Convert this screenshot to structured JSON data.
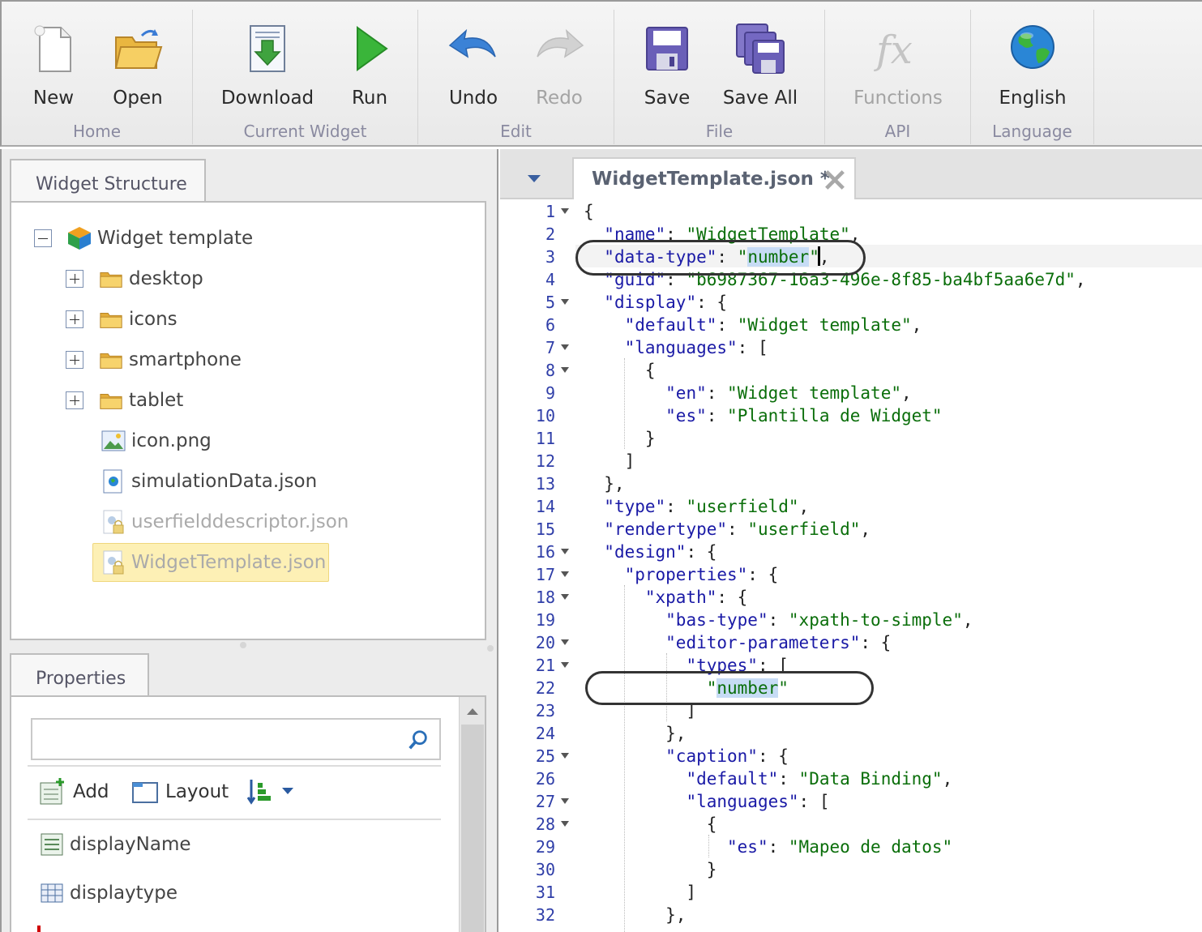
{
  "ribbon": {
    "groups": [
      {
        "label": "Home",
        "buttons": [
          {
            "label": "New"
          },
          {
            "label": "Open"
          }
        ]
      },
      {
        "label": "Current Widget",
        "buttons": [
          {
            "label": "Download"
          },
          {
            "label": "Run"
          }
        ]
      },
      {
        "label": "Edit",
        "buttons": [
          {
            "label": "Undo"
          },
          {
            "label": "Redo"
          }
        ]
      },
      {
        "label": "File",
        "buttons": [
          {
            "label": "Save"
          },
          {
            "label": "Save All"
          }
        ]
      },
      {
        "label": "API",
        "buttons": [
          {
            "label": "Functions"
          }
        ]
      },
      {
        "label": "Language",
        "buttons": [
          {
            "label": "English"
          }
        ]
      }
    ]
  },
  "structure": {
    "tab_label": "Widget Structure",
    "root": "Widget template",
    "folders": [
      "desktop",
      "icons",
      "smartphone",
      "tablet"
    ],
    "files": [
      "icon.png",
      "simulationData.json",
      "userfielddescriptor.json",
      "WidgetTemplate.json"
    ],
    "selected": "WidgetTemplate.json"
  },
  "properties": {
    "tab_label": "Properties",
    "search_value": "",
    "toolbar": {
      "add_label": "Add",
      "layout_label": "Layout"
    },
    "items": [
      "displayName",
      "displaytype"
    ]
  },
  "editor": {
    "tab_title": "WidgetTemplate.json *",
    "lines": [
      "{",
      "  \"name\": \"WidgetTemplate\",",
      "  \"data-type\": \"number\",",
      "  \"guid\": \"b6987367-16a3-496e-8f85-ba4bf5aa6e7d\",",
      "  \"display\": {",
      "    \"default\": \"Widget template\",",
      "    \"languages\": [",
      "      {",
      "        \"en\": \"Widget template\",",
      "        \"es\": \"Plantilla de Widget\"",
      "      }",
      "    ]",
      "  },",
      "  \"type\": \"userfield\",",
      "  \"rendertype\": \"userfield\",",
      "  \"design\": {",
      "    \"properties\": {",
      "      \"xpath\": {",
      "        \"bas-type\": \"xpath-to-simple\",",
      "        \"editor-parameters\": {",
      "          \"types\": [",
      "            \"number\"",
      "          ]",
      "        },",
      "        \"caption\": {",
      "          \"default\": \"Data Binding\",",
      "          \"languages\": [",
      "            {",
      "              \"es\": \"Mapeo de datos\"",
      "            }",
      "          ]",
      "        },"
    ]
  }
}
